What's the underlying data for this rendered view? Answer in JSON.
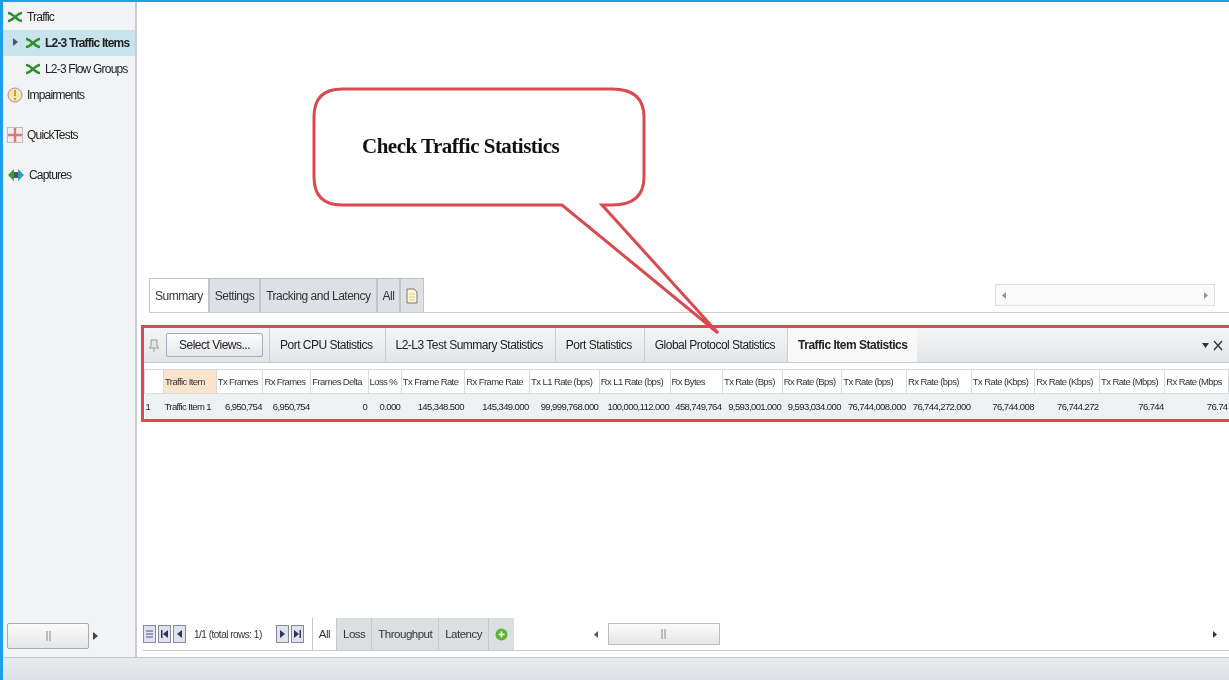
{
  "sidebar": {
    "items": [
      {
        "label": "Traffic",
        "kind": "traffic",
        "selected": false,
        "children": [
          {
            "label": "L2-3 Traffic Items",
            "kind": "traffic",
            "selected": true,
            "expandable": true
          },
          {
            "label": "L2-3 Flow Groups",
            "kind": "traffic",
            "selected": false,
            "expandable": false
          }
        ]
      },
      {
        "label": "Impairments",
        "kind": "impairments",
        "selected": false
      },
      {
        "label": "QuickTests",
        "kind": "quicktests",
        "selected": false
      },
      {
        "label": "Captures",
        "kind": "captures",
        "selected": false
      }
    ]
  },
  "callout": {
    "text": "Check Traffic Statistics"
  },
  "view_tabs": [
    {
      "label": "Summary",
      "selected": true
    },
    {
      "label": "Settings",
      "selected": false
    },
    {
      "label": "Tracking and Latency",
      "selected": false
    },
    {
      "label": "All",
      "selected": false
    }
  ],
  "stats_panel": {
    "select_button": "Select Views...",
    "tabs": [
      {
        "label": "Port CPU Statistics",
        "selected": false
      },
      {
        "label": "L2-L3 Test Summary Statistics",
        "selected": false
      },
      {
        "label": "Port Statistics",
        "selected": false
      },
      {
        "label": "Global Protocol Statistics",
        "selected": false
      },
      {
        "label": "Traffic Item Statistics",
        "selected": true
      }
    ],
    "table": {
      "columns": [
        "Traffic Item",
        "Tx Frames",
        "Rx Frames",
        "Frames Delta",
        "Loss %",
        "Tx Frame Rate",
        "Rx Frame Rate",
        "Tx L1 Rate (bps)",
        "Rx L1 Rate (bps)",
        "Rx Bytes",
        "Tx Rate (Bps)",
        "Rx Rate (Bps)",
        "Tx Rate (bps)",
        "Rx Rate (bps)",
        "Tx Rate (Kbps)",
        "Rx Rate (Kbps)",
        "Tx Rate (Mbps)",
        "Rx Rate (Mbps"
      ],
      "rows": [
        {
          "index": "1",
          "cells": [
            "Traffic Item 1",
            "6,950,754",
            "6,950,754",
            "0",
            "0.000",
            "145,348.500",
            "145,349.000",
            "99,999,768.000",
            "100,000,112.000",
            "458,749,764",
            "9,593,001.000",
            "9,593,034.000",
            "76,744,008.000",
            "76,744,272.000",
            "76,744.008",
            "76,744.272",
            "76.744",
            "76.74"
          ]
        }
      ]
    }
  },
  "pager": {
    "text": "1/1 (total rows: 1)"
  },
  "filter_tabs": [
    {
      "label": "All",
      "selected": true
    },
    {
      "label": "Loss",
      "selected": false
    },
    {
      "label": "Throughput",
      "selected": false
    },
    {
      "label": "Latency",
      "selected": false
    }
  ]
}
